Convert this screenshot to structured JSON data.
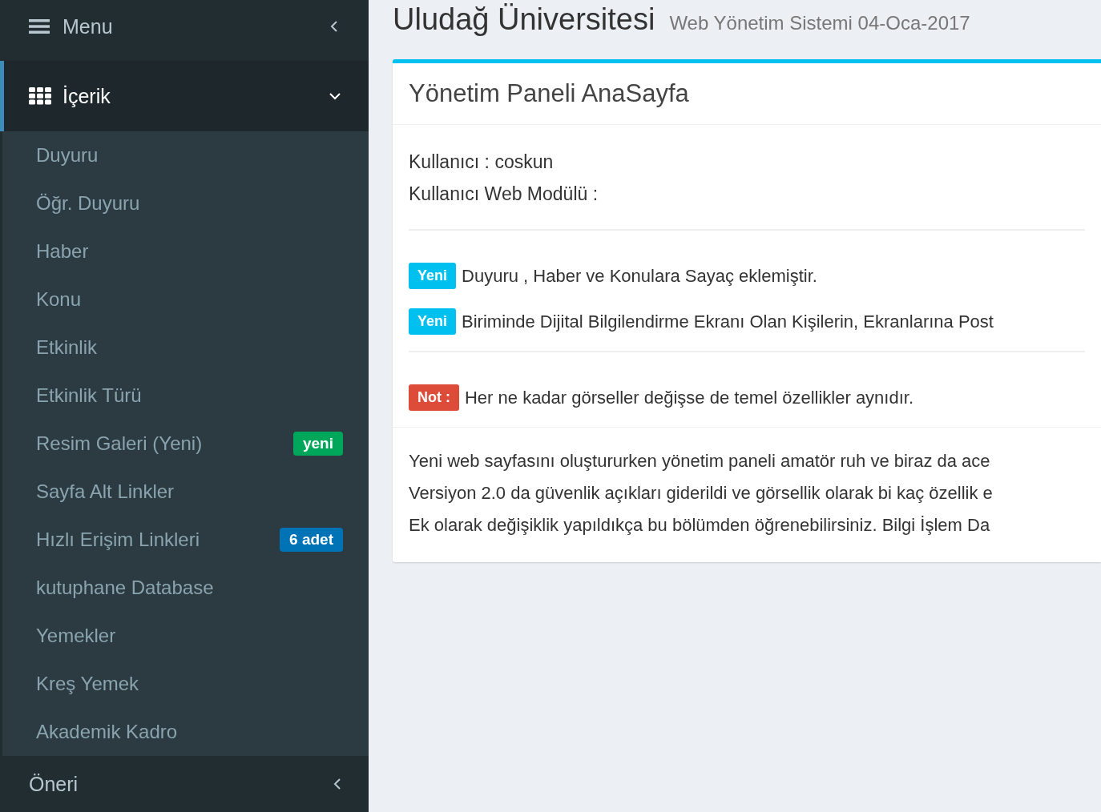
{
  "sidebar": {
    "header": {
      "title": "Menu"
    },
    "sections": [
      {
        "label": "İçerik",
        "expanded": true,
        "items": [
          {
            "label": "Duyuru"
          },
          {
            "label": "Öğr. Duyuru"
          },
          {
            "label": "Haber"
          },
          {
            "label": "Konu"
          },
          {
            "label": "Etkinlik"
          },
          {
            "label": "Etkinlik Türü"
          },
          {
            "label": "Resim Galeri (Yeni)",
            "badge": {
              "text": "yeni",
              "color": "#00a65a"
            }
          },
          {
            "label": "Sayfa Alt Linkler"
          },
          {
            "label": "Hızlı Erişim Linkleri",
            "badge": {
              "text": "6 adet",
              "color": "#0073b7"
            }
          },
          {
            "label": "kutuphane Database"
          },
          {
            "label": "Yemekler"
          },
          {
            "label": "Kreş Yemek"
          },
          {
            "label": "Akademik Kadro"
          }
        ]
      },
      {
        "label": "Öneri",
        "expanded": false
      }
    ]
  },
  "page": {
    "title": "Uludağ Üniversitesi",
    "subtitle": "Web Yönetim Sistemi 04-Oca-2017"
  },
  "box": {
    "title": "Yönetim Paneli AnaSayfa",
    "user_lines": [
      "Kullanıcı : coskun",
      "Kullanıcı Web Modülü :"
    ],
    "notice_groups": [
      [
        {
          "kind": "info",
          "tag": "Yeni",
          "text": "Duyuru , Haber ve Konulara Sayaç eklemiştir."
        },
        {
          "kind": "info",
          "tag": "Yeni",
          "text": "Biriminde Dijital Bilgilendirme Ekranı Olan Kişilerin, Ekranlarına Post"
        }
      ],
      [
        {
          "kind": "danger",
          "tag": "Not :",
          "text": "Her ne kadar görseller değişse de temel özellikler aynıdır."
        }
      ]
    ],
    "footer_lines": [
      "Yeni web sayfasını oluştururken yönetim paneli amatör ruh ve biraz da ace",
      "Versiyon 2.0 da güvenlik açıkları giderildi ve görsellik olarak bi kaç özellik e",
      "Ek olarak değişiklik yapıldıkça bu bölümden öğrenebilirsiniz. Bilgi İşlem Da"
    ]
  }
}
